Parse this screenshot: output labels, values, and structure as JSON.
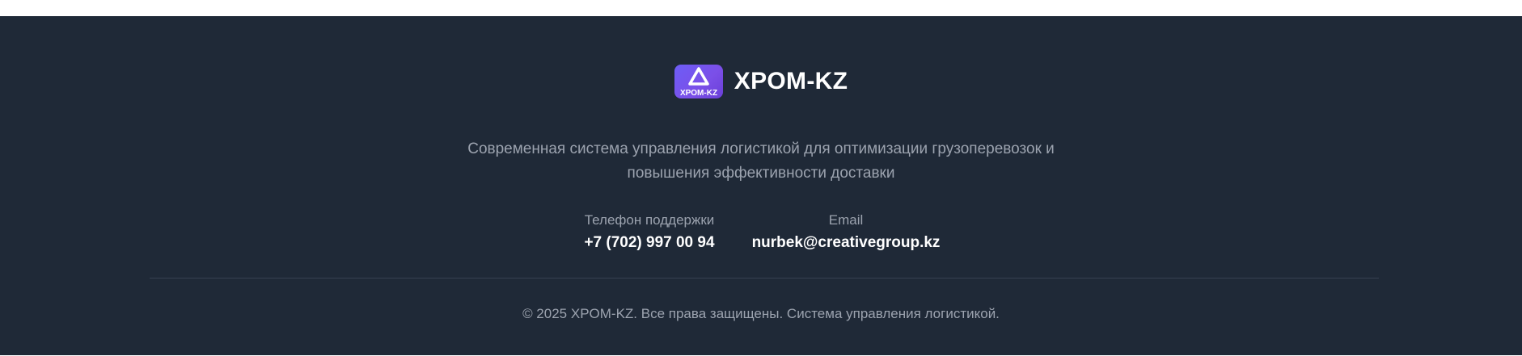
{
  "brand": {
    "logo_text": "XPOM-KZ",
    "name": "XPOM-KZ",
    "logo_colors": [
      "#6d5df6",
      "#6a3fd8"
    ]
  },
  "tagline": {
    "line1": "Современная система управления логистикой для оптимизации грузоперевозок и",
    "line2": "повышения эффективности доставки"
  },
  "contacts": {
    "phone": {
      "label": "Телефон поддержки",
      "value": "+7 (702) 997 00 94"
    },
    "email": {
      "label": "Email",
      "value": "nurbek@creativegroup.kz"
    }
  },
  "copyright": "© 2025 XPOM-KZ. Все права защищены. Система управления логистикой.",
  "colors": {
    "background": "#1f2937",
    "text_primary": "#ffffff",
    "text_muted": "#9ca3af",
    "divider": "#374151"
  }
}
